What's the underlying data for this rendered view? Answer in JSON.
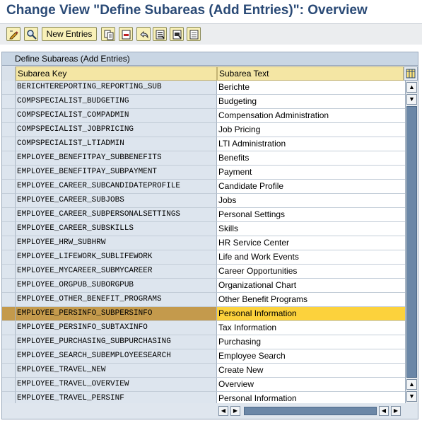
{
  "window": {
    "title": "Change View \"Define Subareas (Add Entries)\": Overview"
  },
  "toolbar": {
    "buttons": [
      {
        "icon": "edit-pencil-icon"
      },
      {
        "icon": "display-glasses-icon"
      },
      {
        "label": "New Entries"
      },
      {
        "icon": "copy-as-icon"
      },
      {
        "icon": "delete-icon"
      },
      {
        "icon": "undo-change-icon"
      },
      {
        "icon": "select-all-icon"
      },
      {
        "icon": "select-block-icon"
      },
      {
        "icon": "deselect-all-icon"
      }
    ]
  },
  "table": {
    "title": "Define Subareas (Add Entries)",
    "columns": [
      "Subarea Key",
      "Subarea Text"
    ],
    "selected_row_index": 16,
    "rows": [
      {
        "key": "BERICHTEREPORTING_REPORTING_SUB",
        "text": "Berichte"
      },
      {
        "key": "COMPSPECIALIST_BUDGETING",
        "text": "Budgeting"
      },
      {
        "key": "COMPSPECIALIST_COMPADMIN",
        "text": "Compensation Administration"
      },
      {
        "key": "COMPSPECIALIST_JOBPRICING",
        "text": "Job Pricing"
      },
      {
        "key": "COMPSPECIALIST_LTIADMIN",
        "text": "LTI Administration"
      },
      {
        "key": "EMPLOYEE_BENEFITPAY_SUBBENEFITS",
        "text": "Benefits"
      },
      {
        "key": "EMPLOYEE_BENEFITPAY_SUBPAYMENT",
        "text": "Payment"
      },
      {
        "key": "EMPLOYEE_CAREER_SUBCANDIDATEPROFILE",
        "text": "Candidate Profile"
      },
      {
        "key": "EMPLOYEE_CAREER_SUBJOBS",
        "text": "Jobs"
      },
      {
        "key": "EMPLOYEE_CAREER_SUBPERSONALSETTINGS",
        "text": "Personal Settings"
      },
      {
        "key": "EMPLOYEE_CAREER_SUBSKILLS",
        "text": "Skills"
      },
      {
        "key": "EMPLOYEE_HRW_SUBHRW",
        "text": "HR Service Center"
      },
      {
        "key": "EMPLOYEE_LIFEWORK_SUBLIFEWORK",
        "text": "Life and Work Events"
      },
      {
        "key": "EMPLOYEE_MYCAREER_SUBMYCAREER",
        "text": "Career Opportunities"
      },
      {
        "key": "EMPLOYEE_ORGPUB_SUBORGPUB",
        "text": "Organizational Chart"
      },
      {
        "key": "EMPLOYEE_OTHER_BENEFIT_PROGRAMS",
        "text": "Other Benefit Programs"
      },
      {
        "key": "EMPLOYEE_PERSINFO_SUBPERSINFO",
        "text": "Personal Information"
      },
      {
        "key": "EMPLOYEE_PERSINFO_SUBTAXINFO",
        "text": "Tax Information"
      },
      {
        "key": "EMPLOYEE_PURCHASING_SUBPURCHASING",
        "text": "Purchasing"
      },
      {
        "key": "EMPLOYEE_SEARCH_SUBEMPLOYEESEARCH",
        "text": "Employee Search"
      },
      {
        "key": "EMPLOYEE_TRAVEL_NEW",
        "text": "Create New"
      },
      {
        "key": "EMPLOYEE_TRAVEL_OVERVIEW",
        "text": "Overview"
      },
      {
        "key": "EMPLOYEE_TRAVEL_PERSINF",
        "text": "Personal Information"
      }
    ]
  },
  "colors": {
    "title": "#2a4a76",
    "selected_key_bg": "#c49a4c",
    "selected_text_bg": "#fcd23c",
    "header_bg": "#f4e6a4",
    "scroll_thumb": "#6b87a7"
  }
}
